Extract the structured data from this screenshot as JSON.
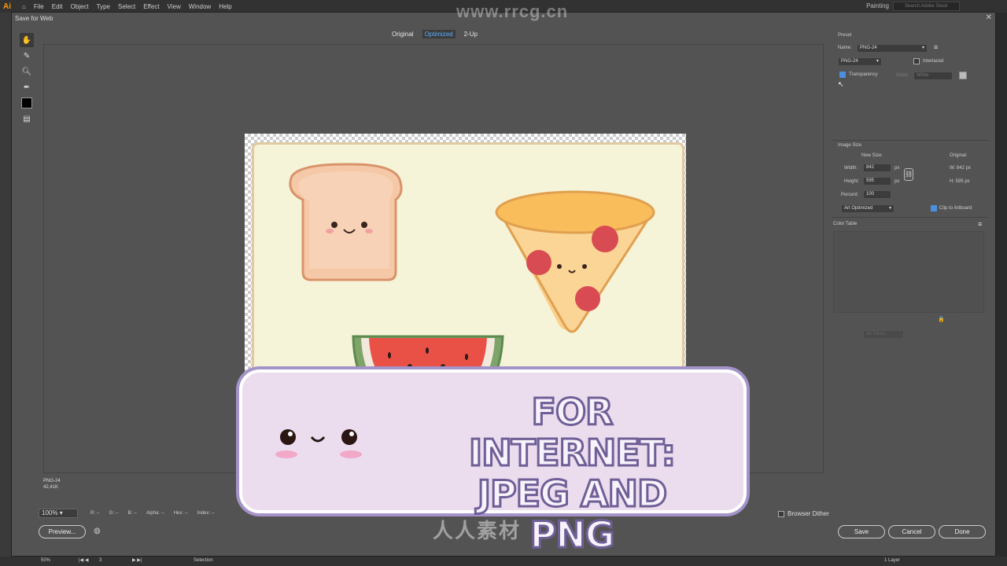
{
  "app": {
    "logo": "Ai",
    "menus": [
      "File",
      "Edit",
      "Object",
      "Type",
      "Select",
      "Effect",
      "View",
      "Window",
      "Help"
    ],
    "workspace": "Painting",
    "search_placeholder": "Search Adobe Stock"
  },
  "dialog": {
    "title": "Save for Web",
    "view_tabs": [
      "Original",
      "Optimized",
      "2-Up"
    ],
    "active_tab": "Optimized",
    "status": {
      "format": "PNG-24",
      "size": "42,41K"
    },
    "zoom": "100%",
    "readouts": [
      "R: --",
      "G: --",
      "B: --",
      "Alpha: --",
      "Hex: --",
      "Index: --"
    ],
    "browser_dither": "Browser Dither",
    "buttons": {
      "preview": "Preview...",
      "save": "Save",
      "cancel": "Cancel",
      "done": "Done"
    }
  },
  "panel": {
    "preset_label": "Preset",
    "name_label": "Name:",
    "name_value": "PNG-24",
    "format_value": "PNG-24",
    "interlaced": "Interlaced",
    "transparency": "Transparency",
    "matte_label": "Matte:",
    "matte_value": "White",
    "image_size": "Image Size",
    "new_size": "New Size:",
    "original": "Original:",
    "width_label": "Width:",
    "width_value": "842",
    "height_label": "Height:",
    "height_value": "595",
    "unit": "px",
    "percent_label": "Percent:",
    "percent_value": "100",
    "orig_w": "W:  842 px",
    "orig_h": "H:  595 px",
    "resample": "Art Optimized",
    "clip": "Clip to Artboard",
    "color_table": "Color Table",
    "preset_bottom": "All Slices"
  },
  "promo": {
    "line1": "FOR INTERNET:",
    "line2": "JPEG AND PNG"
  },
  "watermark": {
    "top": "www.rrcg.cn",
    "bottom": "人人素材"
  },
  "appbar": {
    "zoom": "50%",
    "page": "3",
    "tool": "Selection",
    "layers": "1 Layer"
  },
  "colors": {
    "accent": "#4a8fe0",
    "dialog_bg": "#535353",
    "promo_bg": "#ebdcee",
    "promo_outline": "#a493c8"
  }
}
